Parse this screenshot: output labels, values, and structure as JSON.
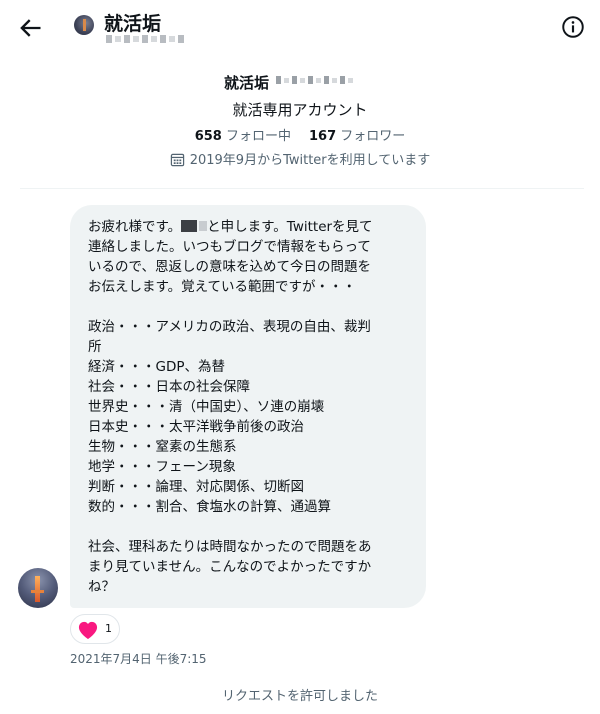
{
  "header": {
    "back_icon": "arrow-left-icon",
    "display_name": "就活垢",
    "info_icon": "info-circle-icon"
  },
  "profile": {
    "display_name": "就活垢",
    "bio": "就活専用アカウント",
    "following_count": "658",
    "following_label": "フォロー中",
    "followers_count": "167",
    "followers_label": "フォロワー",
    "joined_icon": "calendar-icon",
    "joined_text": "2019年9月からTwitterを利用しています"
  },
  "message": {
    "text_before_name": "お疲れ様です。",
    "text_after_name": "と申します。Twitterを見て\n連絡しました。いつもブログで情報をもらって\nいるので、恩返しの意味を込めて今日の問題を\nお伝えします。覚えている範囲ですが・・・\n\n政治・・・アメリカの政治、表現の自由、裁判\n所\n経済・・・GDP、為替\n社会・・・日本の社会保障\n世界史・・・清（中国史）、ソ連の崩壊\n日本史・・・太平洋戦争前後の政治\n生物・・・窒素の生態系\n地学・・・フェーン現象\n判断・・・論理、対応関係、切断図\n数的・・・割合、食塩水の計算、通過算\n\n社会、理科あたりは時間なかったので問題をあ\nまり見ていません。こんなのでよかったですか\nね？",
    "reaction_icon": "heart-icon",
    "reaction_count": "1",
    "timestamp": "2021年7月4日 午後7:15"
  },
  "footer": {
    "request_status": "リクエストを許可しました"
  },
  "colors": {
    "bubble_bg": "#eff3f4",
    "secondary_text": "#536471",
    "heart": "#f91880"
  }
}
